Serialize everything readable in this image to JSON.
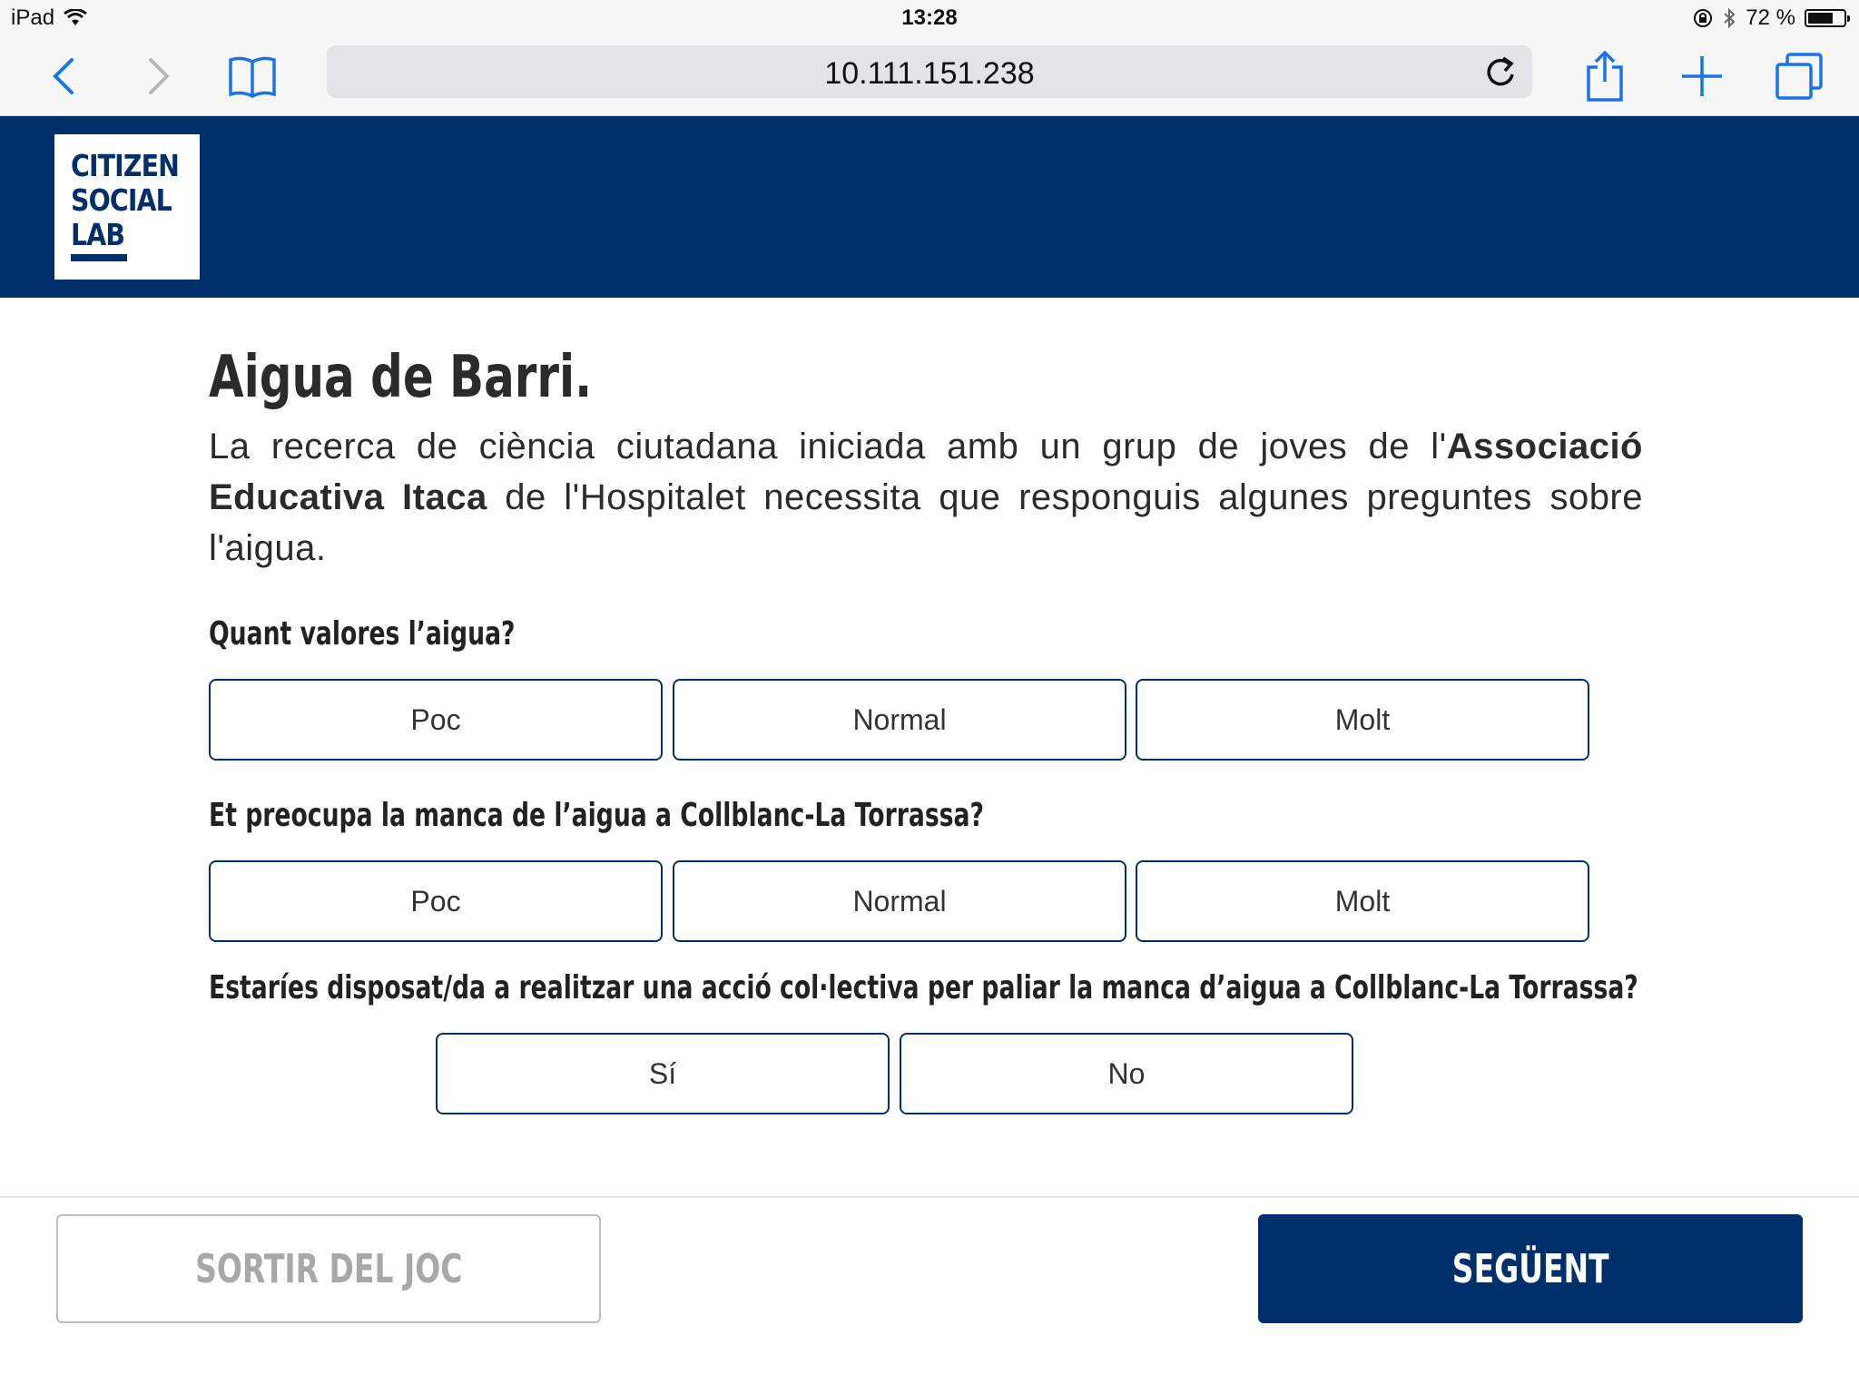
{
  "status_bar": {
    "device": "iPad",
    "time": "13:28",
    "battery": "72 %",
    "battery_level": 0.72
  },
  "browser": {
    "url": "10.111.151.238",
    "icons": [
      "back-icon",
      "forward-icon",
      "bookmarks-icon",
      "reload-icon",
      "share-icon",
      "new-tab-icon",
      "tabs-icon"
    ]
  },
  "logo": {
    "line1": "CITIZEN",
    "line2": "SOCIAL",
    "line3": "LAB"
  },
  "page": {
    "title": "Aigua de Barri.",
    "intro_part1": "La recerca de ciència ciutadana iniciada amb un grup de joves de l'",
    "intro_bold": "Associació Educativa Itaca",
    "intro_part2": " de l'Hospitalet necessita que responguis algunes preguntes sobre l'aigua."
  },
  "questions": [
    {
      "text": "Quant valores l’aigua?",
      "options": [
        "Poc",
        "Normal",
        "Molt"
      ]
    },
    {
      "text": "Et preocupa la manca de l’aigua a Collblanc-La Torrassa?",
      "options": [
        "Poc",
        "Normal",
        "Molt"
      ]
    },
    {
      "text": "Estaríes disposat/da a realitzar una acció col·lectiva per paliar la manca d’aigua a Collblanc-La Torrassa?",
      "options": [
        "Sí",
        "No"
      ]
    }
  ],
  "footer": {
    "exit_label": "SORTIR DEL JOC",
    "next_label": "SEGÜENT"
  },
  "colors": {
    "brand_navy": "#00306b",
    "text": "#2b2b2b",
    "disabled": "#a8a8a8"
  }
}
